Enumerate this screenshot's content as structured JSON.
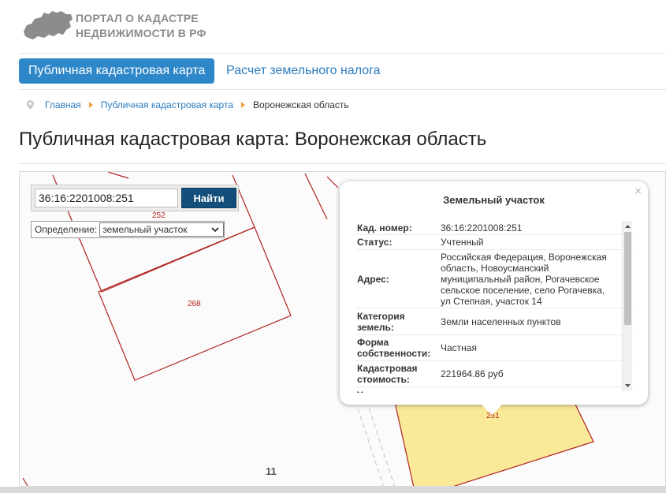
{
  "header": {
    "brand_line1": "ПОРТАЛ О КАДАСТРЕ",
    "brand_line2": "НЕДВИЖИМОСТИ В РФ",
    "logo_icon": "russia-map-icon"
  },
  "nav": {
    "active_tab": "Публичная кадастровая карта",
    "link_tab": "Расчет земельного налога"
  },
  "breadcrumb": {
    "items": [
      "Главная",
      "Публичная кадастровая карта"
    ],
    "current": "Воронежская область"
  },
  "page_title": "Публичная кадастровая карта: Воронежская область",
  "map": {
    "search_value": "36:16:2201008:251",
    "search_button": "Найти",
    "definition_label": "Определение:",
    "definition_value": "земельный участок",
    "parcel_labels": [
      "252",
      "268",
      "251"
    ],
    "block_label": "11",
    "parcel_line_color": "#b0231f",
    "selected_parcel_fill": "#fbe99a"
  },
  "popup": {
    "title": "Земельный участок",
    "close_symbol": "×",
    "rows": [
      {
        "key": "Кад. номер:",
        "value": "36:16:2201008:251"
      },
      {
        "key": "Статус:",
        "value": "Учтенный"
      },
      {
        "key": "Адрес:",
        "value": "Российская Федерация, Воронежская область, Новоусманский муниципальный район, Рогачевское сельское поселение, село Рогачевка, ул Степная, участок 14"
      },
      {
        "key": "Категория земель:",
        "value": "Земли населенных пунктов"
      },
      {
        "key": "Форма собственности:",
        "value": "Частная"
      },
      {
        "key": "Кадастровая стоимость:",
        "value": "221964.86 руб"
      },
      {
        "key": "Уточненная",
        "value": ""
      }
    ]
  }
}
